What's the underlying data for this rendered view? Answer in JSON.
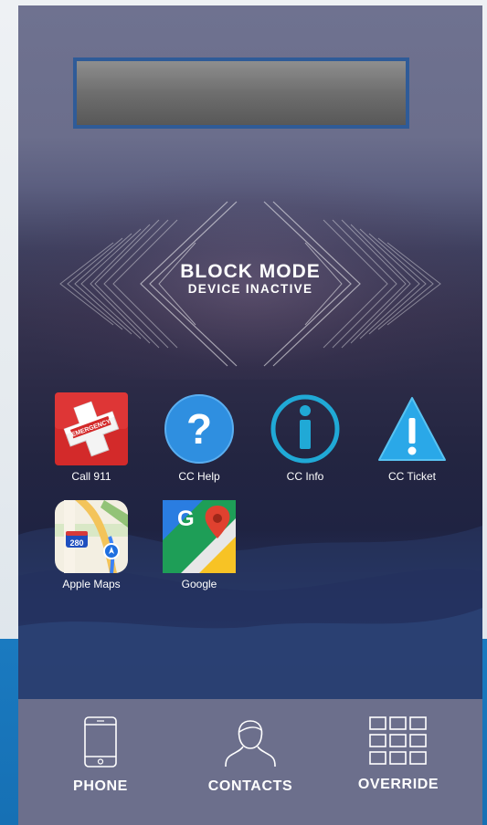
{
  "status": {
    "title": "BLOCK MODE",
    "subtitle": "DEVICE INACTIVE"
  },
  "apps": [
    {
      "label": "Call 911",
      "icon": "emergency-cross-icon"
    },
    {
      "label": "CC Help",
      "icon": "question-mark-icon"
    },
    {
      "label": "CC Info",
      "icon": "info-icon"
    },
    {
      "label": "CC Ticket",
      "icon": "warning-triangle-icon"
    },
    {
      "label": "Apple Maps",
      "icon": "apple-maps-icon",
      "route_number": "280"
    },
    {
      "label": "Google",
      "icon": "google-maps-icon",
      "letter": "G"
    }
  ],
  "emergency_badge": "EMERGENCY",
  "dock": [
    {
      "label": "PHONE",
      "icon": "phone-icon"
    },
    {
      "label": "CONTACTS",
      "icon": "contacts-icon"
    },
    {
      "label": "OVERRIDE",
      "icon": "grid-icon"
    }
  ],
  "colors": {
    "banner_border": "#2f5b98",
    "dock_background": "#6c6f8c",
    "help_blue": "#2f8fe0",
    "info_cyan": "#20a9d6",
    "ticket_blue": "#2aa8e8",
    "emergency_red": "#d32a2a"
  }
}
